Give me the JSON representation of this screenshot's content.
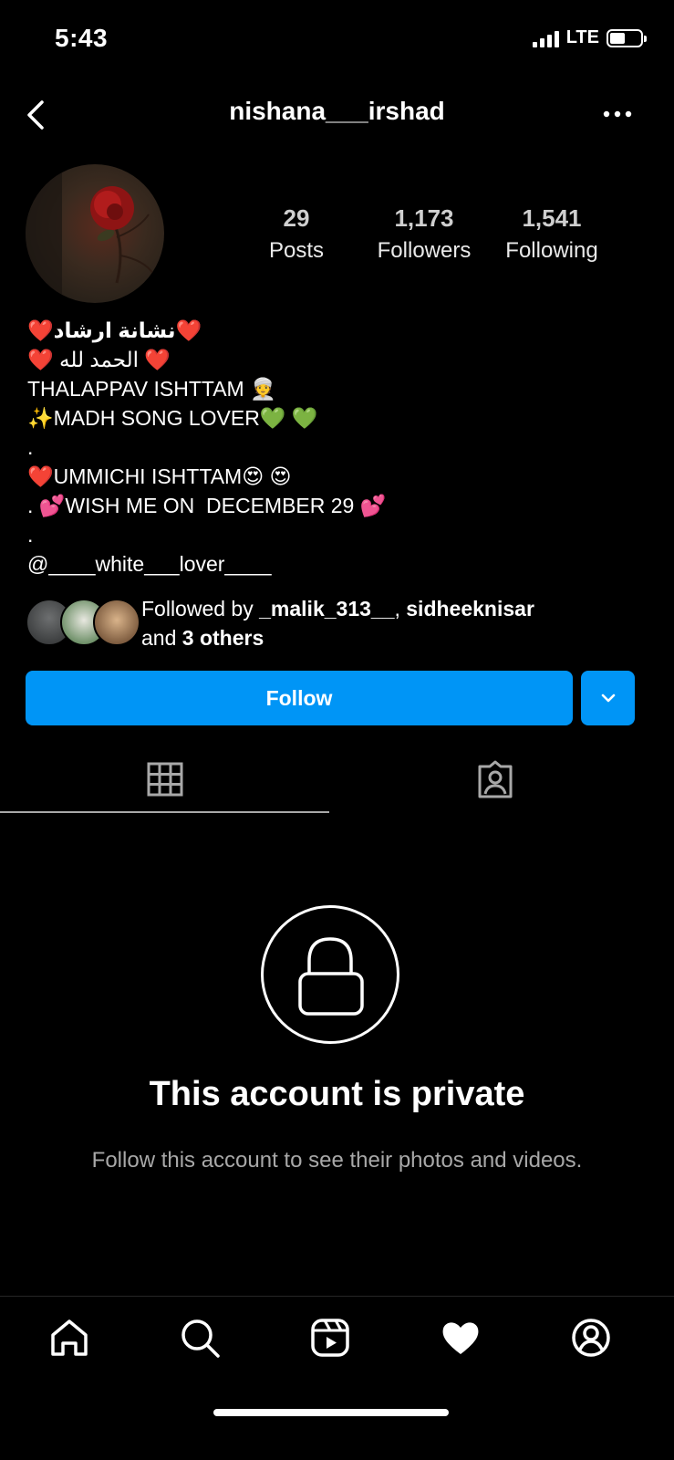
{
  "status_bar": {
    "time": "5:43",
    "network": "LTE",
    "signal_strength": 4,
    "battery_level": 0.45
  },
  "header": {
    "username": "nishana___irshad",
    "back_icon": "chevron-left-icon",
    "more_icon": "more-horizontal-icon"
  },
  "stats": {
    "posts": {
      "count": "29",
      "label": "Posts"
    },
    "followers": {
      "count": "1,173",
      "label": "Followers"
    },
    "following": {
      "count": "1,541",
      "label": "Following"
    }
  },
  "bio": {
    "lines": [
      "❤️نشانة ارشاد❤️",
      "❤️ الحمد لله ❤️",
      "THALAPPAV ISHTTAM 👳",
      "✨MADH SONG LOVER💚 💚",
      ".",
      "❤️UMMICHI ISHTTAM😍 😍",
      ". 💕WISH ME ON  DECEMBER 29 💕",
      ".",
      "@____white___lover____"
    ]
  },
  "followed_by": {
    "prefix": "Followed by ",
    "user1": "_malik_313__",
    "separator": ", ",
    "user2": "sidheeknisar",
    "and": "and ",
    "others": "3 others"
  },
  "actions": {
    "follow_label": "Follow",
    "dropdown_icon": "chevron-down-icon"
  },
  "tabs": [
    {
      "name": "grid",
      "icon": "grid-icon",
      "active": true
    },
    {
      "name": "tagged",
      "icon": "tagged-person-icon",
      "active": false
    }
  ],
  "private": {
    "title": "This account is private",
    "subtitle": "Follow this account to see their photos and videos."
  },
  "bottom_nav": [
    {
      "name": "home",
      "icon": "home-icon"
    },
    {
      "name": "search",
      "icon": "search-icon"
    },
    {
      "name": "reels",
      "icon": "reels-icon"
    },
    {
      "name": "activity",
      "icon": "heart-icon"
    },
    {
      "name": "profile",
      "icon": "profile-icon"
    }
  ],
  "colors": {
    "background": "#000000",
    "primary_button": "#0095f6",
    "secondary_text": "#a8a8a8"
  }
}
